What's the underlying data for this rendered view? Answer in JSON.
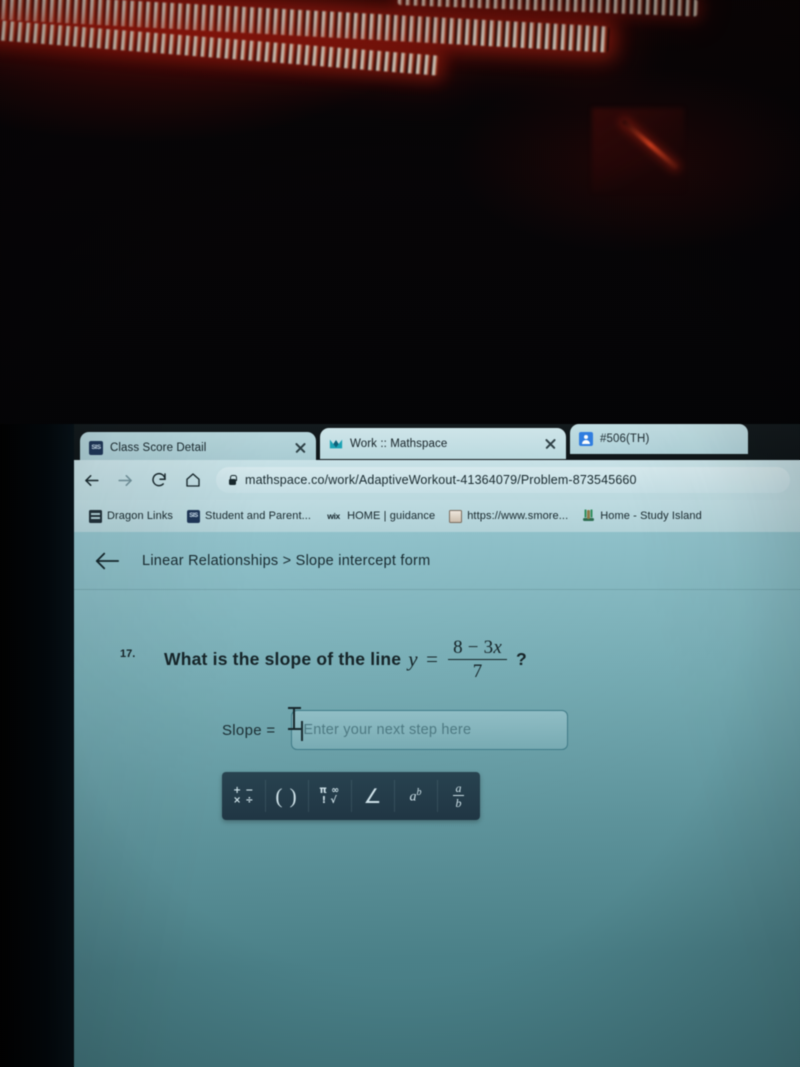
{
  "scene": {
    "description": "photo-of-laptop-screen-in-dark-room",
    "led_strip_color": "#ff3c1e",
    "screen_tint": "#78aeb6"
  },
  "browser": {
    "tabs": [
      {
        "title": "Class Score Detail",
        "favicon": "sis-icon",
        "favicon_text": "SIS",
        "active": false,
        "has_close": true
      },
      {
        "title": "Work :: Mathspace",
        "favicon": "mathspace-logo-icon",
        "favicon_text": "M",
        "active": true,
        "has_close": true
      },
      {
        "title": "#506(TH)",
        "favicon": "contacts-icon",
        "favicon_text": "",
        "active": false,
        "has_close": false
      }
    ],
    "nav": {
      "back_label": "Back",
      "forward_label": "Forward",
      "reload_label": "Reload",
      "home_label": "Home"
    },
    "omnibox": {
      "url": "mathspace.co/work/AdaptiveWorkout-41364079/Problem-873545660",
      "secure": true
    },
    "bookmarks": [
      {
        "label": "Dragon Links",
        "icon": "folder-icon",
        "icon_text": ""
      },
      {
        "label": "Student and Parent...",
        "icon": "sis-icon",
        "icon_text": "SIS"
      },
      {
        "label": "HOME | guidance",
        "icon": "wix-icon",
        "icon_text": "wix"
      },
      {
        "label": "https://www.smore...",
        "icon": "smore-icon",
        "icon_text": ""
      },
      {
        "label": "Home - Study Island",
        "icon": "study-island-icon",
        "icon_text": ""
      }
    ]
  },
  "page": {
    "breadcrumb": "Linear Relationships > Slope intercept form",
    "back_button_label": "Back",
    "question": {
      "number": "17.",
      "prompt_before": "What is the slope of the line",
      "variable": "y",
      "equals": "=",
      "fraction_numerator": "8 − 3x",
      "fraction_numerator_plain": "8 − 3",
      "fraction_numerator_var": "x",
      "fraction_denominator": "7",
      "prompt_after": "?"
    },
    "answer": {
      "label": "Slope  =",
      "value": "",
      "placeholder": "Enter your next step here",
      "focused": true
    },
    "math_toolbar": [
      {
        "name": "operators-button",
        "glyph_top": "+ −",
        "glyph_bottom": "× ÷",
        "title": "Operators"
      },
      {
        "name": "parentheses-button",
        "glyph": "( )",
        "title": "Parentheses"
      },
      {
        "name": "symbols-button",
        "glyph_top": "π ∞",
        "glyph_bottom": "! √",
        "title": "Symbols"
      },
      {
        "name": "angle-button",
        "glyph": "∠",
        "title": "Angle"
      },
      {
        "name": "exponent-button",
        "glyph_base": "a",
        "glyph_sup": "b",
        "title": "Exponent"
      },
      {
        "name": "fraction-button",
        "glyph_num": "a",
        "glyph_den": "b",
        "title": "Fraction"
      }
    ]
  }
}
